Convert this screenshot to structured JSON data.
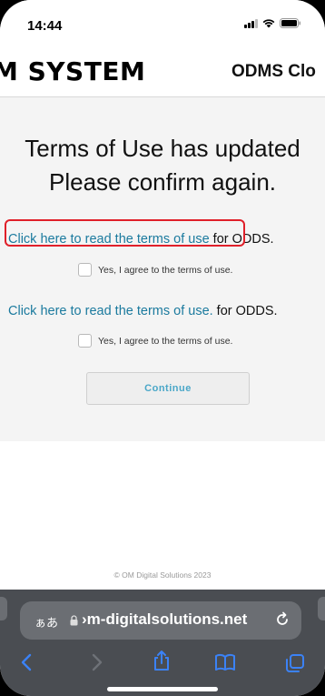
{
  "status_bar": {
    "time": "14:44"
  },
  "header": {
    "logo": "M SYSTEM",
    "product": "ODMS Clo"
  },
  "main": {
    "title_line1": "Terms of Use has updated",
    "title_line2": "Please confirm again.",
    "terms": [
      {
        "link": "Click here to read the terms of use",
        "suffix": " for ODDS.",
        "agree": "Yes, I agree to the terms of use."
      },
      {
        "link": "Click here to read the terms of use.",
        "suffix": " for ODDS.",
        "agree": "Yes, I agree to the terms of use."
      }
    ],
    "continue_label": "Continue"
  },
  "footer": {
    "copyright": "© OM Digital Solutions 2023"
  },
  "browser": {
    "aa": "ぁあ",
    "url": "›m-digitalsolutions.net"
  },
  "colors": {
    "link": "#1b7a9e",
    "highlight": "#e0202a",
    "browser_bar": "#4a4d52",
    "toolbar_icons": "#3b82f6"
  }
}
